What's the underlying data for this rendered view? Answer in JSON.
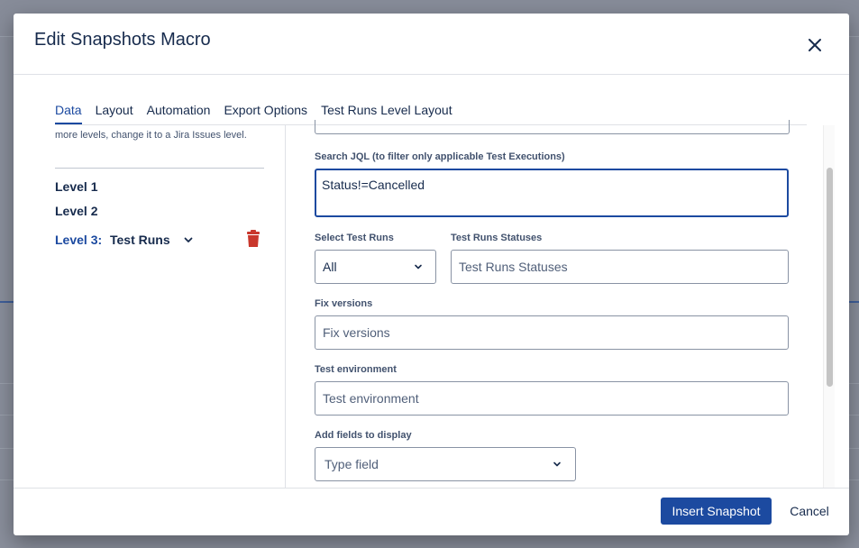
{
  "dialog": {
    "title": "Edit Snapshots Macro"
  },
  "tabs": [
    {
      "label": "Data",
      "active": true
    },
    {
      "label": "Layout",
      "active": false
    },
    {
      "label": "Automation",
      "active": false
    },
    {
      "label": "Export Options",
      "active": false
    },
    {
      "label": "Test Runs Level Layout",
      "active": false
    }
  ],
  "left_panel": {
    "note": "more levels, change it to a Jira Issues level.",
    "levels": {
      "level1": "Level 1",
      "level2": "Level 2",
      "level3_prefix": "Level 3:",
      "level3_value": "Test Runs"
    }
  },
  "form": {
    "search_jql": {
      "label": "Search JQL (to filter only applicable Test Executions)",
      "value": "Status!=Cancelled"
    },
    "select_test_runs": {
      "label": "Select Test Runs",
      "value": "All"
    },
    "test_runs_statuses": {
      "label": "Test Runs Statuses",
      "placeholder": "Test Runs Statuses"
    },
    "fix_versions": {
      "label": "Fix versions",
      "placeholder": "Fix versions"
    },
    "test_environment": {
      "label": "Test environment",
      "placeholder": "Test environment"
    },
    "add_fields": {
      "label": "Add fields to display",
      "placeholder": "Type field"
    }
  },
  "footer": {
    "primary_label": "Insert Snapshot",
    "cancel_label": "Cancel"
  },
  "icons": {
    "close": "close-icon",
    "chevron": "chevron-down-icon",
    "delete": "trash-icon"
  },
  "colors": {
    "accent": "#1c4aa0",
    "danger": "#c9372c",
    "text": "#172b4d"
  }
}
